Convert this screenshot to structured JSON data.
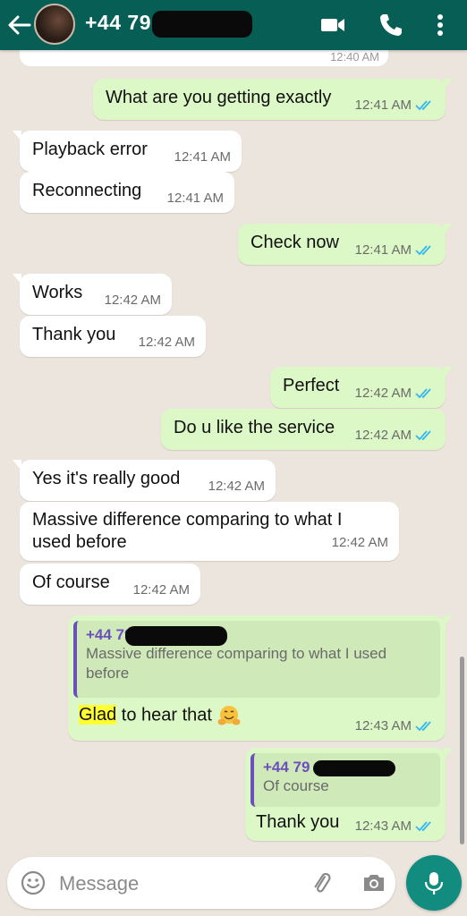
{
  "header": {
    "contact_name": "+44 79",
    "icons": [
      "back-arrow-icon",
      "video-call-icon",
      "voice-call-icon",
      "more-options-icon"
    ]
  },
  "messages": [
    {
      "dir": "out",
      "text": "What are you getting exactly",
      "time": "12:41 AM",
      "status": "read"
    },
    {
      "dir": "in",
      "text": "Playback error",
      "time": "12:41 AM"
    },
    {
      "dir": "in",
      "text": "Reconnecting",
      "time": "12:41 AM"
    },
    {
      "dir": "out",
      "text": "Check now",
      "time": "12:41 AM",
      "status": "read"
    },
    {
      "dir": "in",
      "text": "Works",
      "time": "12:42 AM"
    },
    {
      "dir": "in",
      "text": "Thank you",
      "time": "12:42 AM"
    },
    {
      "dir": "out",
      "text": "Perfect",
      "time": "12:42 AM",
      "status": "read"
    },
    {
      "dir": "out",
      "text": "Do u like the service",
      "time": "12:42 AM",
      "status": "read"
    },
    {
      "dir": "in",
      "text": "Yes it's really good",
      "time": "12:42 AM"
    },
    {
      "dir": "in",
      "text_line1": "Massive difference comparing to what I",
      "text_line2": "used before",
      "time": "12:42 AM"
    },
    {
      "dir": "in",
      "text": "Of course",
      "time": "12:42 AM"
    },
    {
      "dir": "out",
      "quote_author": "+44 79",
      "quote_text": "Massive difference comparing to what I used before",
      "highlight": "Glad",
      "text_rest": " to hear that",
      "emoji": "hugging-face-emoji",
      "time": "12:43 AM",
      "status": "read"
    },
    {
      "dir": "out",
      "quote_author": "+44 79",
      "quote_text": "Of course",
      "text": "Thank you",
      "time": "12:43 AM",
      "status": "read"
    }
  ],
  "composer": {
    "placeholder": "Message"
  },
  "colors": {
    "header": "#075e54",
    "chat_bg": "#ece5dd",
    "incoming": "#ffffff",
    "outgoing": "#dcf8c6",
    "read_ticks": "#34b7f1",
    "quote_author": "#6b4fbb",
    "mic_button": "#128c7e"
  }
}
